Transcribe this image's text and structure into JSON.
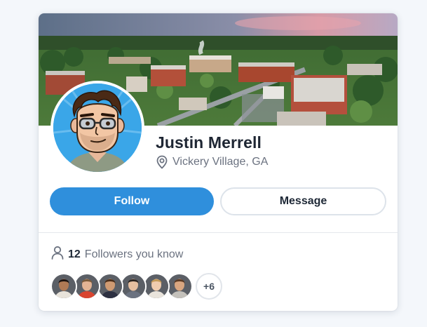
{
  "profile": {
    "name": "Justin Merrell",
    "location": "Vickery Village, GA"
  },
  "actions": {
    "follow_label": "Follow",
    "message_label": "Message"
  },
  "followers": {
    "count": "12",
    "label": "Followers you know",
    "more": "+6",
    "avatars": [
      {
        "skin": "#b07a55",
        "hair": "#1d1410",
        "shirt": "#e8e3da"
      },
      {
        "skin": "#e2b394",
        "hair": "#7a5a3a",
        "shirt": "#d9442f"
      },
      {
        "skin": "#cf9a72",
        "hair": "#4a2e1a",
        "shirt": "#2d3142"
      },
      {
        "skin": "#e6bfa0",
        "hair": "#2b2420",
        "shirt": "#6b7280"
      },
      {
        "skin": "#f0ccae",
        "hair": "#c59a57",
        "shirt": "#e9e4dc"
      },
      {
        "skin": "#d9a680",
        "hair": "#5b3b25",
        "shirt": "#c4c1bb"
      }
    ]
  },
  "colors": {
    "accent": "#2f8fdc",
    "page_bg": "#f4f7fb",
    "name_text": "#1e2633",
    "muted_text": "#6b7280"
  },
  "icons": {
    "location": "map-pin-icon",
    "followers": "user-icon"
  }
}
